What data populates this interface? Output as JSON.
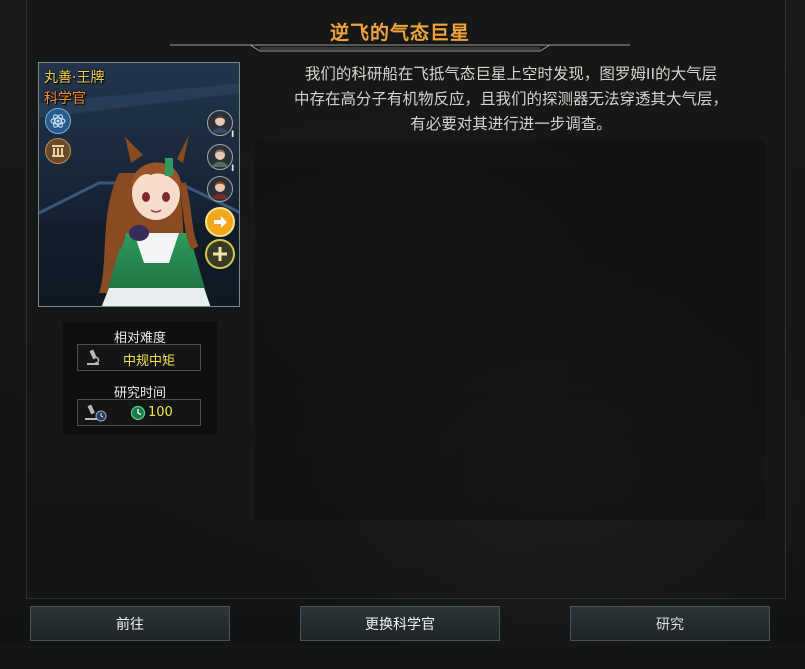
{
  "dialog": {
    "title": "逆飞的气态巨星",
    "description_lines": [
      "我们的科研船在飞抵气态巨星上空时发现，图罗姆II的大气层",
      "中存在高分子有机物反应，且我们的探测器无法穿透其大气层，",
      "有必要对其进行进一步调查。"
    ]
  },
  "scientist": {
    "name": "丸善·王牌",
    "role": "科学官",
    "level_marks": [
      "I",
      "I"
    ]
  },
  "difficulty": {
    "label": "相对难度",
    "value": "中规中矩"
  },
  "research_time": {
    "label": "研究时间",
    "value": "100"
  },
  "buttons": {
    "goto": "前往",
    "change_scientist": "更换科学官",
    "research": "研究"
  },
  "colors": {
    "title": "#f0a43a",
    "name": "#f2d14a",
    "role": "#f08a2a",
    "value": "#f2e24a",
    "button_bg": "#262d30"
  },
  "icons": [
    "atom-icon",
    "pillar-icon",
    "portrait-icon",
    "arrow-right-icon",
    "plus-icon",
    "microscope-icon",
    "clock-icon"
  ]
}
